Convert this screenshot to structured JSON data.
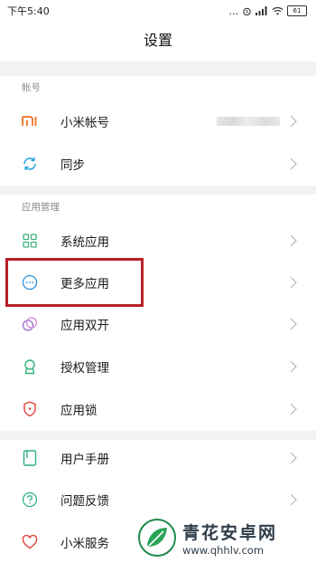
{
  "status_bar": {
    "time": "下午5:40",
    "dots": "...",
    "battery": "61"
  },
  "header": {
    "title": "设置"
  },
  "sections": {
    "account": {
      "label": "帐号",
      "items": [
        {
          "label": "小米帐号",
          "icon": "mi-logo-icon",
          "color": "#f37020"
        },
        {
          "label": "同步",
          "icon": "sync-icon",
          "color": "#2aa9e0"
        }
      ]
    },
    "apps": {
      "label": "应用管理",
      "items": [
        {
          "label": "系统应用",
          "icon": "grid-icon",
          "color": "#3fb47a"
        },
        {
          "label": "更多应用",
          "icon": "more-dots-icon",
          "color": "#2d8fd6"
        },
        {
          "label": "应用双开",
          "icon": "dual-app-icon",
          "color": "#9b6fd8"
        },
        {
          "label": "授权管理",
          "icon": "badge-icon",
          "color": "#2fb37b"
        },
        {
          "label": "应用锁",
          "icon": "shield-lock-icon",
          "color": "#e0443b"
        }
      ]
    },
    "help": {
      "items": [
        {
          "label": "用户手册",
          "icon": "book-icon",
          "color": "#2fae8a"
        },
        {
          "label": "问题反馈",
          "icon": "question-icon",
          "color": "#2fae8a"
        },
        {
          "label": "小米服务",
          "icon": "heart-icon",
          "color": "#e0443b"
        }
      ]
    }
  },
  "watermark": {
    "title": "青花安卓网",
    "url": "www.qhhlv.com"
  }
}
